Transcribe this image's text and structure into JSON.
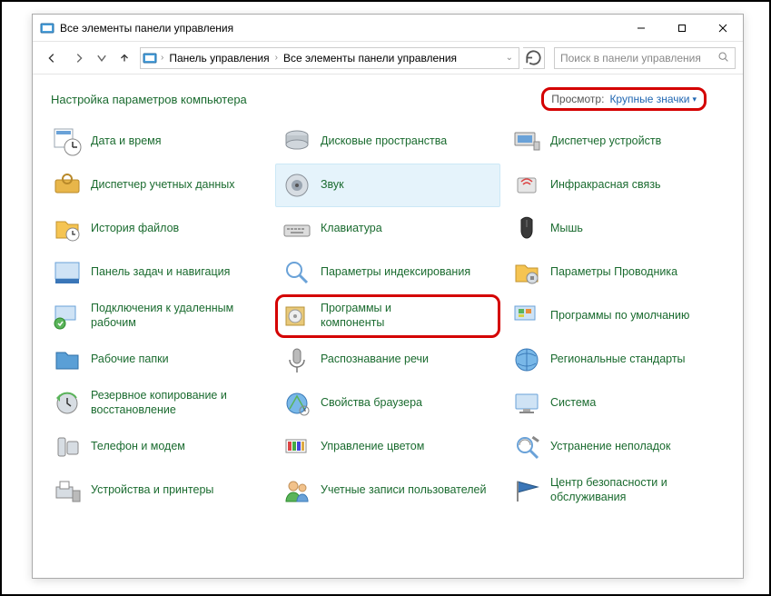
{
  "window": {
    "title": "Все элементы панели управления"
  },
  "breadcrumbs": {
    "root": "Панель управления",
    "current": "Все элементы панели управления"
  },
  "search": {
    "placeholder": "Поиск в панели управления"
  },
  "header": {
    "title": "Настройка параметров компьютера",
    "view_label": "Просмотр:",
    "view_value": "Крупные значки"
  },
  "items": [
    {
      "label": "Дата и время",
      "icon": "clock"
    },
    {
      "label": "Дисковые пространства",
      "icon": "disks"
    },
    {
      "label": "Диспетчер устройств",
      "icon": "device-manager"
    },
    {
      "label": "Диспетчер учетных данных",
      "icon": "credentials"
    },
    {
      "label": "Звук",
      "icon": "sound",
      "hover": true
    },
    {
      "label": "Инфракрасная связь",
      "icon": "infrared"
    },
    {
      "label": "История файлов",
      "icon": "file-history"
    },
    {
      "label": "Клавиатура",
      "icon": "keyboard"
    },
    {
      "label": "Мышь",
      "icon": "mouse"
    },
    {
      "label": "Панель задач и навигация",
      "icon": "taskbar"
    },
    {
      "label": "Параметры индексирования",
      "icon": "indexing"
    },
    {
      "label": "Параметры Проводника",
      "icon": "folder-options"
    },
    {
      "label": "Подключения к удаленным рабочим",
      "icon": "remote"
    },
    {
      "label": "Программы и компоненты",
      "icon": "programs",
      "red": true
    },
    {
      "label": "Программы по умолчанию",
      "icon": "default-programs"
    },
    {
      "label": "Рабочие папки",
      "icon": "work-folders"
    },
    {
      "label": "Распознавание речи",
      "icon": "speech"
    },
    {
      "label": "Региональные стандарты",
      "icon": "region"
    },
    {
      "label": "Резервное копирование и восстановление",
      "icon": "backup"
    },
    {
      "label": "Свойства браузера",
      "icon": "internet-options"
    },
    {
      "label": "Система",
      "icon": "system"
    },
    {
      "label": "Телефон и модем",
      "icon": "phone"
    },
    {
      "label": "Управление цветом",
      "icon": "color"
    },
    {
      "label": "Устранение неполадок",
      "icon": "troubleshoot"
    },
    {
      "label": "Устройства и принтеры",
      "icon": "devices-printers"
    },
    {
      "label": "Учетные записи пользователей",
      "icon": "user-accounts"
    },
    {
      "label": "Центр безопасности и обслуживания",
      "icon": "action-center"
    }
  ]
}
